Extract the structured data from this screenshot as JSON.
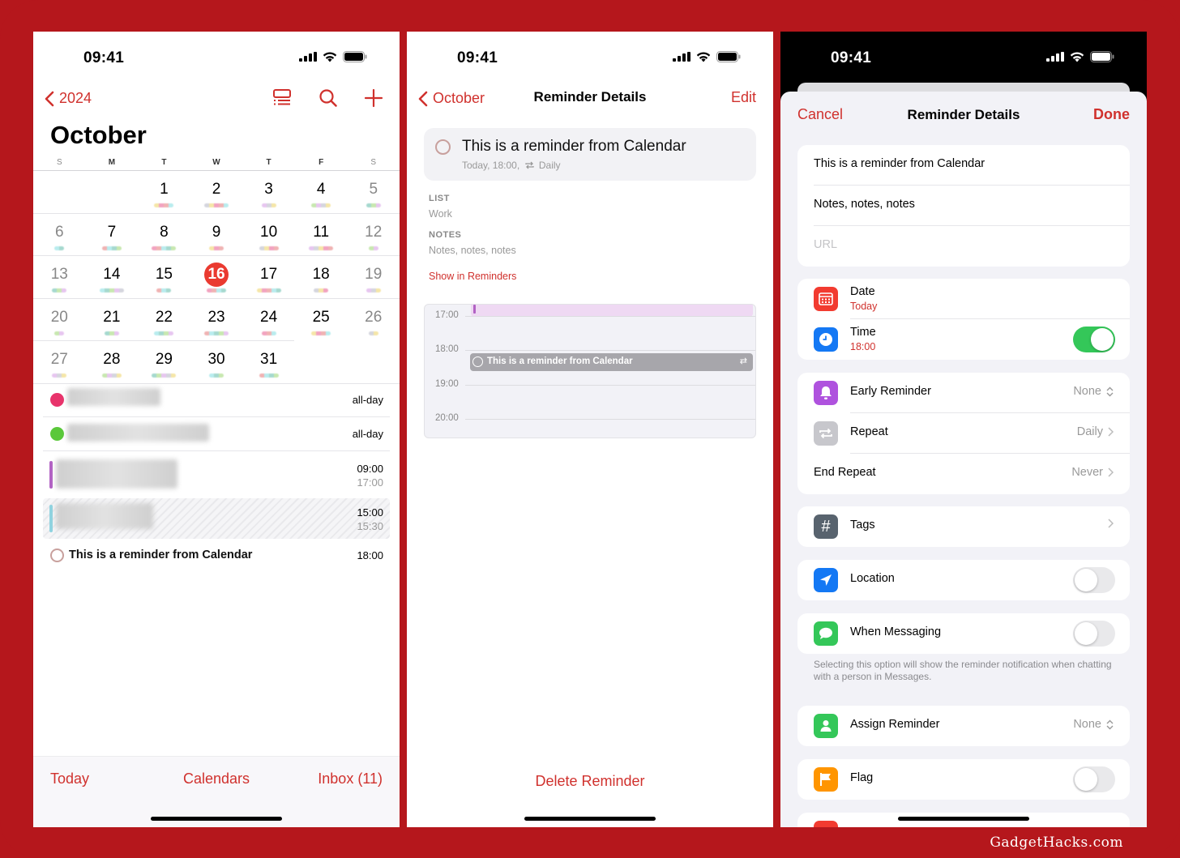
{
  "colors": {
    "accent": "#d0312d",
    "frame": "#b5171c",
    "today_badge": "#ea3a30",
    "toggle_on": "#34c759"
  },
  "status_bar": {
    "time": "09:41"
  },
  "calendar_screen": {
    "back_label": "2024",
    "toolbar_icons": [
      "list-view-icon",
      "search-icon",
      "add-icon"
    ],
    "month_title": "October",
    "weekdays": [
      "S",
      "M",
      "T",
      "W",
      "T",
      "F",
      "S"
    ],
    "today": 16,
    "weeks": [
      [
        null,
        null,
        1,
        2,
        3,
        4,
        5
      ],
      [
        6,
        7,
        8,
        9,
        10,
        11,
        12
      ],
      [
        13,
        14,
        15,
        16,
        17,
        18,
        19
      ],
      [
        20,
        21,
        22,
        23,
        24,
        25,
        26
      ],
      [
        27,
        28,
        29,
        30,
        31,
        null,
        null
      ]
    ],
    "events": [
      {
        "title": "[blurred]",
        "time": "all-day",
        "calendar_color": "#e8336b"
      },
      {
        "title": "[blurred]",
        "time": "all-day",
        "calendar_color": "#5ac83a"
      },
      {
        "title": "[blurred]",
        "start": "09:00",
        "end": "17:00",
        "color": "#b262c4"
      },
      {
        "title": "[blurred]",
        "start": "15:00",
        "end": "15:30",
        "color": "#8fd3e0"
      }
    ],
    "reminder": {
      "title": "This is a reminder from Calendar",
      "time": "18:00"
    },
    "tabbar": {
      "today": "Today",
      "calendars": "Calendars",
      "inbox": "Inbox (11)"
    }
  },
  "reminder_details_screen": {
    "back_label": "October",
    "title": "Reminder Details",
    "edit_label": "Edit",
    "reminder_title": "This is a reminder from Calendar",
    "reminder_sub_prefix": "Today, 18:00,",
    "reminder_repeat": "Daily",
    "list_label": "LIST",
    "list_value": "Work",
    "notes_label": "NOTES",
    "notes_value": "Notes, notes, notes",
    "show_in_reminders": "Show in Reminders",
    "day_hours": [
      "17:00",
      "18:00",
      "19:00",
      "20:00"
    ],
    "day_event_title": "This is a reminder from Calendar",
    "delete_label": "Delete Reminder"
  },
  "edit_screen": {
    "cancel_label": "Cancel",
    "title": "Reminder Details",
    "done_label": "Done",
    "title_value": "This is a reminder from Calendar",
    "notes_value": "Notes, notes, notes",
    "url_placeholder": "URL",
    "date_label": "Date",
    "date_value": "Today",
    "time_label": "Time",
    "time_value": "18:00",
    "time_enabled": true,
    "early_reminder_label": "Early Reminder",
    "early_reminder_value": "None",
    "repeat_label": "Repeat",
    "repeat_value": "Daily",
    "end_repeat_label": "End Repeat",
    "end_repeat_value": "Never",
    "tags_label": "Tags",
    "location_label": "Location",
    "location_enabled": false,
    "messaging_label": "When Messaging",
    "messaging_enabled": false,
    "messaging_footnote": "Selecting this option will show the reminder notification when chatting with a person in Messages.",
    "assign_label": "Assign Reminder",
    "assign_value": "None",
    "flag_label": "Flag",
    "flag_enabled": false
  },
  "watermark": "GadgetHacks.com"
}
